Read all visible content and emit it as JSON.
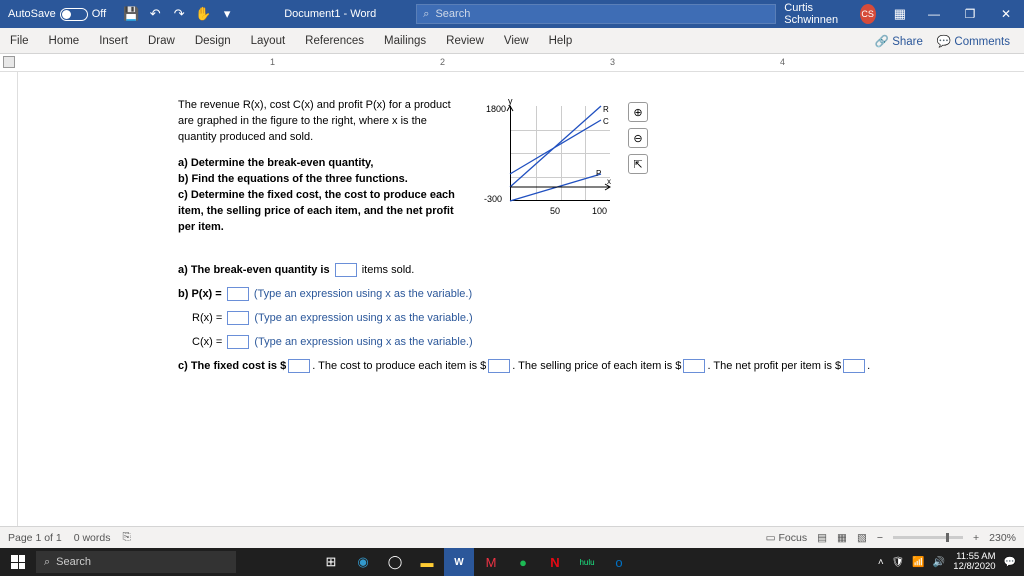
{
  "titlebar": {
    "autosave": "AutoSave",
    "autosave_state": "Off",
    "doc": "Document1 - Word",
    "search_ph": "Search",
    "user": "Curtis Schwinnen",
    "initials": "CS"
  },
  "ribbon": {
    "tabs": [
      "File",
      "Home",
      "Insert",
      "Draw",
      "Design",
      "Layout",
      "References",
      "Mailings",
      "Review",
      "View",
      "Help"
    ],
    "share": "Share",
    "comments": "Comments"
  },
  "ruler": {
    "marks": [
      "1",
      "2",
      "3",
      "4"
    ]
  },
  "problem": {
    "intro": "The revenue R(x), cost C(x) and profit P(x) for a product are graphed in the figure to the right, where x is the quantity produced and sold.",
    "a": "a) Determine the break-even quantity,",
    "b": "b) Find the equations of the three functions.",
    "c": "c) Determine the fixed cost, the cost to produce each item, the selling price of each item, and the net profit per item."
  },
  "answers": {
    "a_pre": "a) The break-even quantity is",
    "a_post": "items sold.",
    "b_p": "b) P(x) =",
    "b_r": "R(x) =",
    "b_c": "C(x) =",
    "hint": "(Type an expression using x as the variable.)",
    "c_fixed": "c) The fixed cost is $",
    "c_prod": ". The cost to produce each item is $",
    "c_sell": ". The selling price of each item is $",
    "c_net": ". The net profit per item is $",
    "c_end": "."
  },
  "chart_data": {
    "type": "line",
    "xlabel": "x",
    "ylabel": "y",
    "xlim": [
      0,
      110
    ],
    "ylim": [
      -300,
      1800
    ],
    "xticks": [
      50,
      100
    ],
    "yticks": [
      -300,
      1800
    ],
    "series": [
      {
        "name": "R",
        "points": [
          [
            0,
            0
          ],
          [
            100,
            1800
          ]
        ]
      },
      {
        "name": "C",
        "points": [
          [
            0,
            300
          ],
          [
            100,
            1500
          ]
        ]
      },
      {
        "name": "P",
        "points": [
          [
            0,
            -300
          ],
          [
            100,
            300
          ]
        ]
      }
    ],
    "labels": {
      "R": "R",
      "C": "C",
      "P": "P",
      "x": "x",
      "y": "y"
    }
  },
  "status": {
    "page": "Page 1 of 1",
    "words": "0 words",
    "focus": "Focus",
    "zoom": "230%",
    "gmail": "Gmail"
  },
  "taskbar": {
    "search": "Search",
    "time": "11:55 AM",
    "date": "12/8/2020"
  }
}
